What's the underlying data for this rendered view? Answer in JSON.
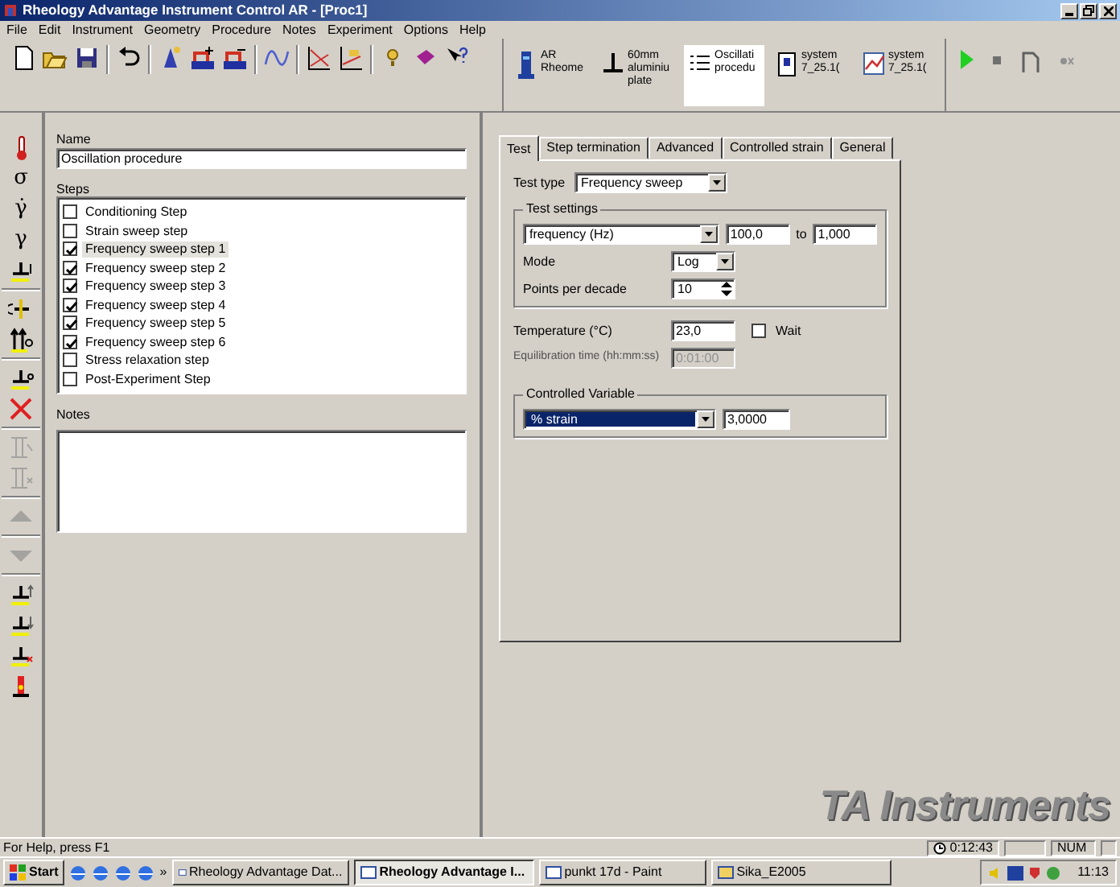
{
  "window": {
    "title": "Rheology Advantage Instrument Control AR - [Proc1]"
  },
  "menu": [
    "File",
    "Edit",
    "Instrument",
    "Geometry",
    "Procedure",
    "Notes",
    "Experiment",
    "Options",
    "Help"
  ],
  "instrument_bar": [
    {
      "kind": "instrument",
      "lines": [
        "AR",
        "Rheome"
      ],
      "selected": false
    },
    {
      "kind": "geometry",
      "lines": [
        "60mm",
        "aluminiu",
        "plate"
      ],
      "selected": false
    },
    {
      "kind": "procedure",
      "lines": [
        "Oscillati",
        "procedu"
      ],
      "selected": true
    },
    {
      "kind": "sample",
      "lines": [
        "system",
        "7_25.1("
      ],
      "selected": false
    },
    {
      "kind": "results",
      "lines": [
        "system",
        "7_25.1("
      ],
      "selected": false
    }
  ],
  "side_toolbar": [
    {
      "kind": "thermometer",
      "disabled": false
    },
    {
      "kind": "glyph",
      "text": "σ",
      "disabled": false
    },
    {
      "kind": "glyph",
      "text": "γ̇",
      "disabled": false
    },
    {
      "kind": "glyph",
      "text": "γ",
      "disabled": false
    },
    {
      "kind": "gap",
      "disabled": false
    },
    {
      "kind": "separator"
    },
    {
      "kind": "rotate",
      "disabled": false
    },
    {
      "kind": "force",
      "disabled": false
    },
    {
      "kind": "separator"
    },
    {
      "kind": "zero",
      "disabled": false
    },
    {
      "kind": "delete",
      "disabled": false
    },
    {
      "kind": "separator"
    },
    {
      "kind": "insert",
      "disabled": true
    },
    {
      "kind": "insert-x",
      "disabled": true
    },
    {
      "kind": "separator"
    },
    {
      "kind": "up",
      "disabled": true
    },
    {
      "kind": "separator"
    },
    {
      "kind": "down",
      "disabled": true
    },
    {
      "kind": "separator"
    },
    {
      "kind": "raise",
      "disabled": false
    },
    {
      "kind": "lower",
      "disabled": false
    },
    {
      "kind": "remove",
      "disabled": false
    },
    {
      "kind": "heater",
      "disabled": false
    }
  ],
  "procedure": {
    "name_label": "Name",
    "name": "Oscillation procedure",
    "steps_label": "Steps",
    "notes_label": "Notes",
    "steps": [
      {
        "label": "Conditioning Step",
        "checked": false,
        "selected": false
      },
      {
        "label": "Strain sweep step",
        "checked": false,
        "selected": false
      },
      {
        "label": "Frequency sweep step 1",
        "checked": true,
        "selected": true
      },
      {
        "label": "Frequency sweep step 2",
        "checked": true,
        "selected": false
      },
      {
        "label": "Frequency sweep step 3",
        "checked": true,
        "selected": false
      },
      {
        "label": "Frequency sweep step 4",
        "checked": true,
        "selected": false
      },
      {
        "label": "Frequency sweep step 5",
        "checked": true,
        "selected": false
      },
      {
        "label": "Frequency sweep step 6",
        "checked": true,
        "selected": false
      },
      {
        "label": "Stress relaxation step",
        "checked": false,
        "selected": false
      },
      {
        "label": "Post-Experiment Step",
        "checked": false,
        "selected": false
      }
    ]
  },
  "dialog": {
    "tabs": [
      {
        "label": "Test",
        "selected": true
      },
      {
        "label": "Step termination",
        "selected": false
      },
      {
        "label": "Advanced",
        "selected": false
      },
      {
        "label": "Controlled strain",
        "selected": false
      },
      {
        "label": "General",
        "selected": false
      }
    ],
    "test_type_label": "Test type",
    "test_type": "Frequency sweep",
    "test_settings": {
      "title": "Test settings",
      "variable": "frequency (Hz)",
      "from": "100,0",
      "to_label": "to",
      "to": "1,000",
      "mode_label": "Mode",
      "mode": "Log",
      "points_label": "Points per decade",
      "points": "10"
    },
    "temperature_label": "Temperature (°C)",
    "temperature": "23,0",
    "wait": {
      "label": "Wait",
      "checked": false
    },
    "equilibration": {
      "label": "Equilibration time (hh:mm:ss)",
      "value": "0:01:00",
      "disabled": true
    },
    "controlled": {
      "title": "Controlled Variable",
      "variable": "% strain",
      "value": "3,0000"
    }
  },
  "logo": "TA Instruments",
  "status_bar": {
    "message": "For Help, press F1",
    "elapsed": "0:12:43",
    "num": "NUM"
  },
  "taskbar": {
    "start": "Start",
    "chevron": "»",
    "tasks": [
      {
        "label": "Rheology Advantage Dat...",
        "selected": false
      },
      {
        "label": "Rheology Advantage I...",
        "selected": true
      },
      {
        "label": "punkt 17d - Paint",
        "selected": false
      },
      {
        "label": "Sika_E2005",
        "selected": false
      }
    ],
    "clock": "11:13"
  }
}
